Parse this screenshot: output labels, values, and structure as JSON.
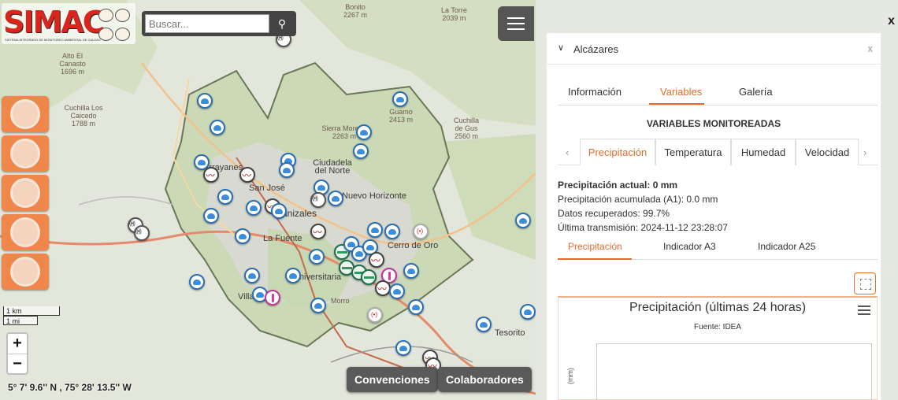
{
  "app": {
    "logo_text": "SIMAC",
    "logo_subtitle": "SISTEMA INTEGRADO DE MONITOREO AMBIENTAL DE CALDAS"
  },
  "search": {
    "placeholder": "Buscar..."
  },
  "map": {
    "places": [
      {
        "name": "Bonito",
        "elev": "2267 m"
      },
      {
        "name": "La Torre",
        "elev": "2039 m"
      },
      {
        "name": "Alto El Canasto",
        "elev": "1696 m"
      },
      {
        "name": "Cuchilla Los Caicedo",
        "elev": "1788 m"
      },
      {
        "name": "Guamo",
        "elev": "2413 m"
      },
      {
        "name": "Cuchilla de Gus",
        "elev": "2560 m"
      },
      {
        "name": "Sierra Morena",
        "elev": "2263 m"
      },
      {
        "name": "Ciudadela del Norte",
        "elev": ""
      },
      {
        "name": "Nuevo Horizonte",
        "elev": ""
      },
      {
        "name": "San José",
        "elev": ""
      },
      {
        "name": "Manizales",
        "elev": ""
      },
      {
        "name": "La Fuente",
        "elev": ""
      },
      {
        "name": "Cerro de Oro",
        "elev": ""
      },
      {
        "name": "Universitaria",
        "elev": ""
      },
      {
        "name": "Morro",
        "elev": ""
      },
      {
        "name": "Tesorito",
        "elev": ""
      },
      {
        "name": "Villamaría",
        "elev": ""
      },
      {
        "name": "Arrayanes",
        "elev": ""
      }
    ],
    "scale_km": "1 km",
    "scale_mi": "1 mi",
    "zoom_in": "+",
    "zoom_out": "−",
    "coordinates": "5° 7' 9.6'' N , 75° 28' 13.5'' W",
    "btn_conventions": "Convenciones",
    "btn_collaborators": "Colaboradores",
    "colors": {
      "accent": "#f0874a",
      "rain_marker": "#3a8ddb",
      "zone": "#6a7d55"
    }
  },
  "panel": {
    "close": "x",
    "card_title": "Alcázares",
    "card_close": "x",
    "tabs": [
      "Información",
      "Variables",
      "Galería"
    ],
    "active_tab": "Variables",
    "section_title": "VARIABLES MONITOREADAS",
    "variable_tabs": [
      "Precipitación",
      "Temperatura",
      "Humedad",
      "Velocidad"
    ],
    "active_variable": "Precipitación",
    "info": {
      "current": "Precipitación actual: 0 mm",
      "accumulated": "Precipitación acumulada (A1): 0.0 mm",
      "recovered": "Datos recuperados: 99.7%",
      "last_tx": "Última transmisión: 2024-11-12 23:28:07"
    },
    "sub_tabs": [
      "Precipitación",
      "Indicador A3",
      "Indicador A25"
    ],
    "chart": {
      "title": "Precipitación (últimas 24 horas)",
      "source": "Fuente: IDEA",
      "ylabel": "(mm)"
    },
    "accent_color": "#e56b2c"
  }
}
